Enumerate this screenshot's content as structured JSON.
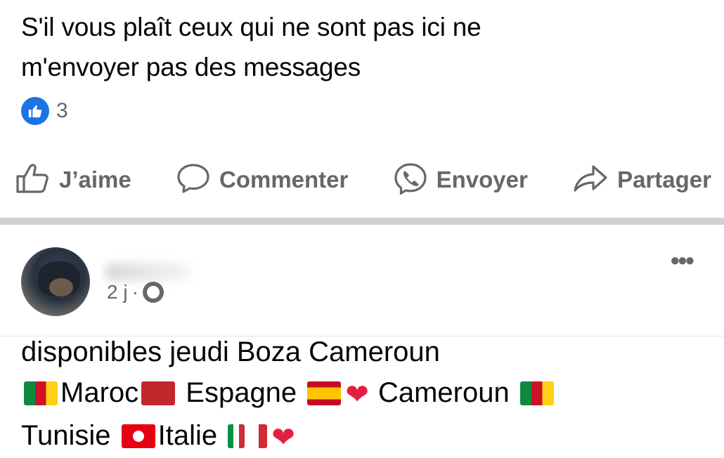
{
  "post1": {
    "text_line1": "S'il vous plaît ceux qui ne sont pas ici ne",
    "text_line2": "m'envoyer pas des messages",
    "reaction_count": "3"
  },
  "actions": {
    "like": "J’aime",
    "comment": "Commenter",
    "send": "Envoyer",
    "share": "Partager"
  },
  "post2": {
    "meta_time": "2 j",
    "meta_dot": "·",
    "line1": "disponibles jeudi Boza Cameroun",
    "maroc": "Maroc",
    "espagne": "Espagne",
    "cameroun": "Cameroun",
    "tunisie": "Tunisie",
    "italie": "Italie",
    "heart": "❤"
  },
  "icons": {
    "like_badge": "thumbs-up-icon",
    "like": "thumbs-up-outline-icon",
    "comment": "speech-bubble-icon",
    "send": "messenger-icon",
    "share": "share-arrow-icon",
    "audience": "globe-icon",
    "more": "more-dots-icon"
  },
  "colors": {
    "like_blue": "#1b74e4",
    "action_gray": "#65676b",
    "heart_red": "#e41e3f"
  }
}
